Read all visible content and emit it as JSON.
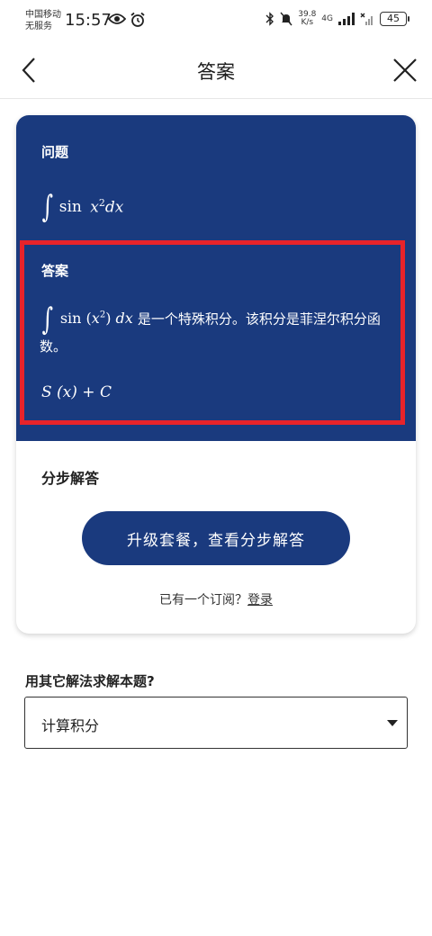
{
  "status_bar": {
    "carrier_line1": "中国移动",
    "carrier_line2": "无服务",
    "time": "15:57",
    "speed_value": "39.8",
    "speed_unit": "K/s",
    "network": "4G",
    "battery": "45",
    "icons": [
      "eye-icon",
      "alarm-icon",
      "bluetooth-icon",
      "mute-icon",
      "signal-icon",
      "wifi-off-icon",
      "battery-icon"
    ]
  },
  "header": {
    "title": "答案",
    "back_icon": "chevron-left-icon",
    "close_icon": "close-icon"
  },
  "card": {
    "question_label": "问题",
    "question_expr": {
      "integral": "∫",
      "func": "sin",
      "var": "x",
      "exp": "2",
      "diff": "dx"
    },
    "answer_label": "答案",
    "answer_expr": {
      "integral": "∫",
      "func": "sin",
      "open": "(",
      "var": "x",
      "exp": "2",
      "close": ")",
      "diff": "dx"
    },
    "answer_text": "是一个特殊积分。该积分是菲涅尔积分函数。",
    "answer_result": "S (x) + C",
    "steps_title": "分步解答",
    "upgrade_button": "升级套餐，查看分步解答",
    "subscription_prompt": "已有一个订阅？",
    "login_link": "登录"
  },
  "other_method": {
    "label": "用其它解法求解本题?",
    "selected": "计算积分"
  },
  "colors": {
    "primary": "#1a3a7e",
    "highlight": "#e8232a"
  }
}
